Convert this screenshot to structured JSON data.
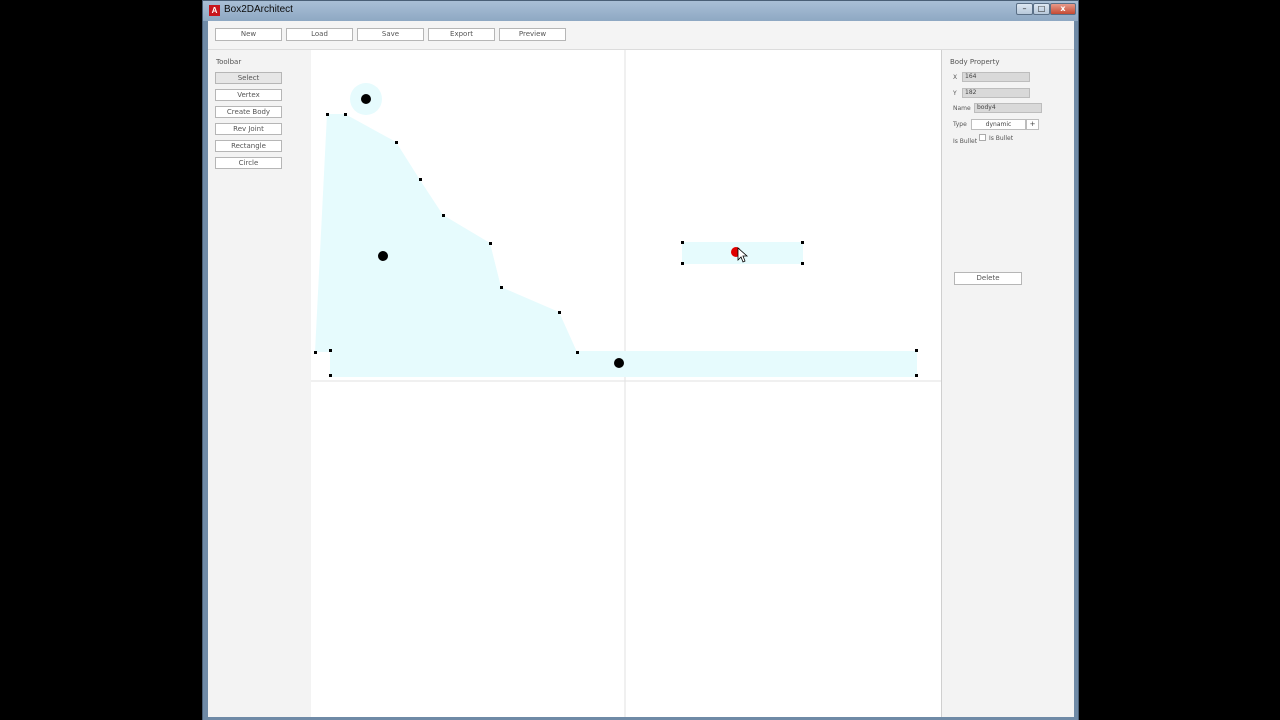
{
  "window": {
    "title": "Box2DArchitect",
    "app_icon_glyph": "A",
    "controls": {
      "minimize": "–",
      "maximize": "□",
      "close": "x"
    }
  },
  "topbar": {
    "buttons": [
      "New",
      "Load",
      "Save",
      "Export",
      "Preview"
    ]
  },
  "toolbar": {
    "title": "Toolbar",
    "items": [
      "Select",
      "Vertex",
      "Create Body",
      "Rev Joint",
      "Rectangle",
      "Circle"
    ],
    "active_item": "Select"
  },
  "properties": {
    "title": "Body Property",
    "x_label": "X",
    "x_value": "164",
    "y_label": "Y",
    "y_value": "182",
    "name_label": "Name",
    "name_value": "body4",
    "type_label": "Type",
    "type_value": "dynamic",
    "type_button": "+",
    "bullet_label": "Is Bullet",
    "bullet_checkbox_label": "Is Bullet",
    "bullet_checked": false,
    "delete_label": "Delete"
  },
  "colors": {
    "shape_fill": "#e6fbfd",
    "body_center": "#000000",
    "selected_body_center": "#e00000",
    "axis_line": "#e2e2e2"
  }
}
